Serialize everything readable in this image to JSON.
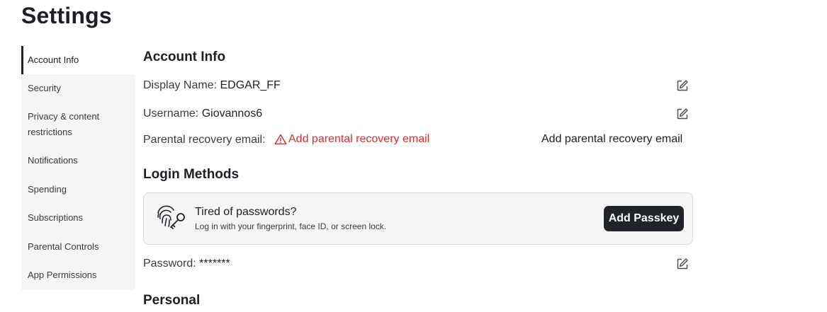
{
  "page": {
    "title": "Settings"
  },
  "sidebar": {
    "items": [
      {
        "label": "Account Info",
        "active": true
      },
      {
        "label": "Security"
      },
      {
        "label": "Privacy & content restrictions"
      },
      {
        "label": "Notifications"
      },
      {
        "label": "Spending"
      },
      {
        "label": "Subscriptions"
      },
      {
        "label": "Parental Controls"
      },
      {
        "label": "App Permissions"
      }
    ]
  },
  "account_info": {
    "heading": "Account Info",
    "display_name_label": "Display Name:",
    "display_name_value": "EDGAR_FF",
    "username_label": "Username:",
    "username_value": "Giovannos6",
    "parental_email_label": "Parental recovery email:",
    "parental_email_warning": "Add parental recovery email",
    "parental_email_action": "Add parental recovery email"
  },
  "login_methods": {
    "heading": "Login Methods",
    "passkey_title": "Tired of passwords?",
    "passkey_subtitle": "Log in with your fingerprint, face ID, or screen lock.",
    "passkey_button": "Add Passkey",
    "password_label": "Password:",
    "password_value": "*******"
  },
  "personal": {
    "heading": "Personal"
  },
  "colors": {
    "warning": "#d32f2f",
    "button_bg": "#202327",
    "sidebar_bg": "#f5f5f6"
  },
  "icons": [
    "edit-icon",
    "warning-triangle-icon",
    "fingerprint-key-icon"
  ]
}
